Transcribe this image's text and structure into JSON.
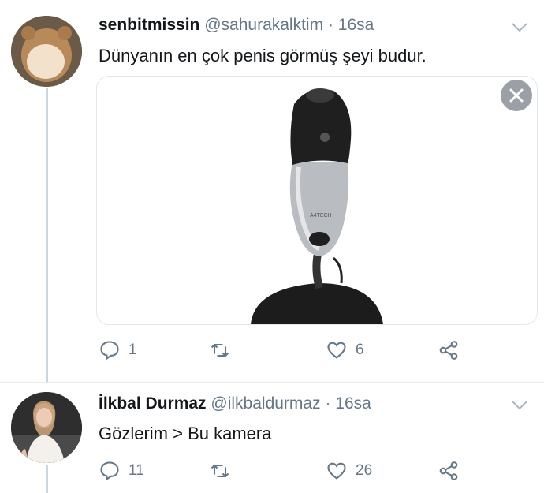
{
  "tweets": [
    {
      "name": "senbitmissin",
      "handle": "@sahurakalktim",
      "time": "16sa",
      "separator": "·",
      "text": "Dünyanın en çok penis görmüş şeyi budur.",
      "replies": "1",
      "retweets": "",
      "likes": "6",
      "media": {
        "brand": "A4TECH"
      }
    },
    {
      "name": "İlkbal Durmaz",
      "handle": "@ilkbaldurmaz",
      "time": "16sa",
      "separator": "·",
      "text": "Gözlerim > Bu kamera",
      "replies": "11",
      "retweets": "",
      "likes": "26"
    }
  ],
  "colors": {
    "text": "#14171a",
    "secondary": "#657786",
    "divider": "#e1e8ed",
    "thread": "#ccd6dd"
  }
}
